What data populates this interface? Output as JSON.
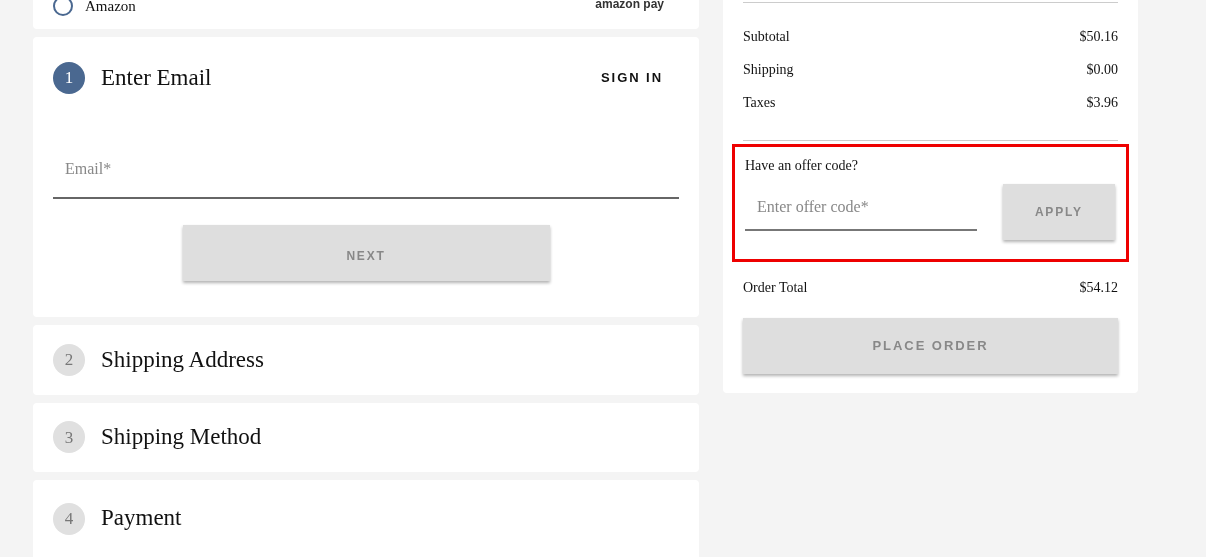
{
  "payment_option": {
    "label": "Amazon",
    "selected": false,
    "logo": "amazon pay"
  },
  "steps": [
    {
      "number": "1",
      "title": "Enter Email",
      "active": true
    },
    {
      "number": "2",
      "title": "Shipping Address",
      "active": false
    },
    {
      "number": "3",
      "title": "Shipping Method",
      "active": false
    },
    {
      "number": "4",
      "title": "Payment",
      "active": false
    }
  ],
  "sign_in": "SIGN IN",
  "email_field": {
    "placeholder": "Email*"
  },
  "next_button": "NEXT",
  "summary": {
    "rows": [
      {
        "label": "Subtotal",
        "value": "$50.16"
      },
      {
        "label": "Shipping",
        "value": "$0.00"
      },
      {
        "label": "Taxes",
        "value": "$3.96"
      }
    ],
    "offer": {
      "heading": "Have an offer code?",
      "placeholder": "Enter offer code*",
      "button": "APPLY",
      "highlighted": true
    },
    "total": {
      "label": "Order Total",
      "value": "$54.12"
    },
    "place_order": "PLACE ORDER"
  }
}
